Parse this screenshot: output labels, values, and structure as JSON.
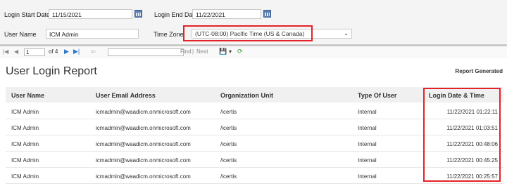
{
  "filters": {
    "login_start_label": "Login Start Date",
    "login_start_value": "11/15/2021",
    "login_end_label": "Login End Date",
    "login_end_value": "11/22/2021",
    "user_name_label": "User Name",
    "user_name_value": "ICM Admin",
    "time_zone_label": "Time Zone",
    "time_zone_value": "(UTC-08:00) Pacific Time (US & Canada)"
  },
  "toolbar": {
    "page_current": "1",
    "page_of": "of 4",
    "find_label": "Find",
    "separator": "|",
    "next_label": "Next"
  },
  "report": {
    "title": "User Login Report",
    "generated_label": "Report Generated",
    "columns": [
      "User Name",
      "User Email Address",
      "Organization Unit",
      "Type Of User",
      "Login Date & Time"
    ],
    "rows": [
      [
        "ICM Admin",
        "icmadmin@waadicm.onmicrosoft.com",
        "/icertis",
        "Internal",
        "11/22/2021 01:22:11"
      ],
      [
        "ICM Admin",
        "icmadmin@waadicm.onmicrosoft.com",
        "/icertis",
        "Internal",
        "11/22/2021 01:03:51"
      ],
      [
        "ICM Admin",
        "icmadmin@waadicm.onmicrosoft.com",
        "/icertis",
        "Internal",
        "11/22/2021 00:48:06"
      ],
      [
        "ICM Admin",
        "icmadmin@waadicm.onmicrosoft.com",
        "/icertis",
        "Internal",
        "11/22/2021 00:45:25"
      ],
      [
        "ICM Admin",
        "icmadmin@waadicm.onmicrosoft.com",
        "/icertis",
        "Internal",
        "11/22/2021 00:25:57"
      ]
    ]
  },
  "colors": {
    "highlight": "#e32227",
    "header_bg": "#f0f0f0",
    "filter_bg": "#f4f4f4",
    "toolbar_accent": "#2b76c6"
  }
}
